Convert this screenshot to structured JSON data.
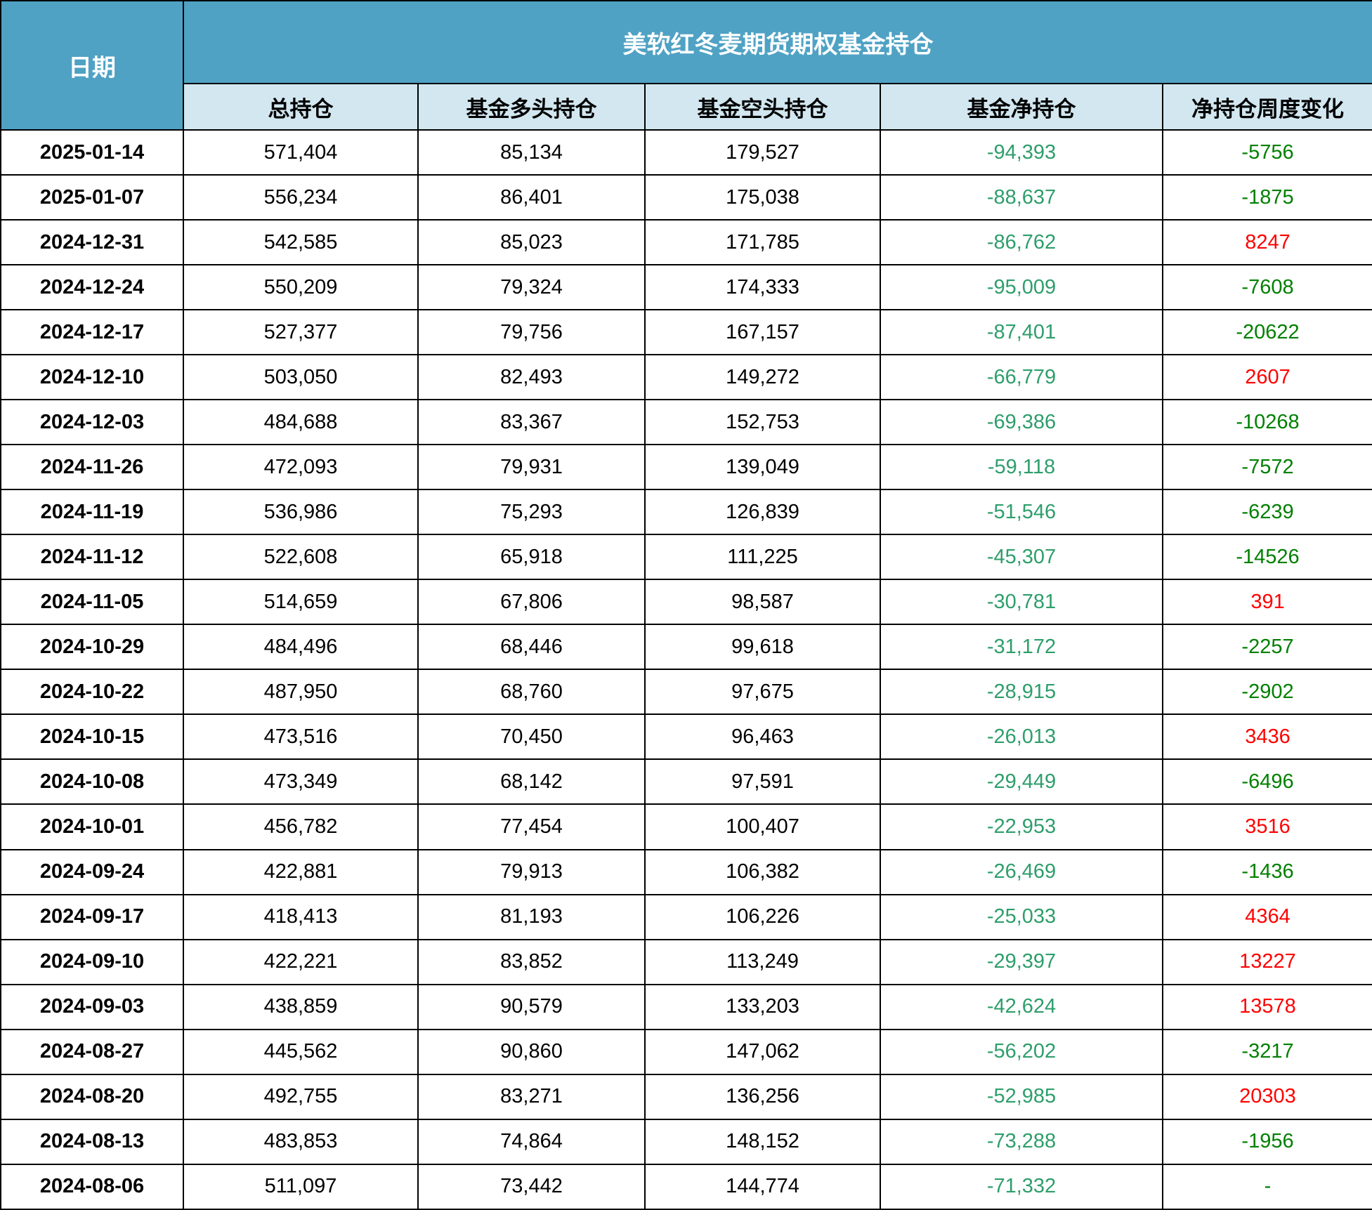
{
  "table": {
    "date_header": "日期",
    "title": "美软红冬麦期货期权基金持仓",
    "columns": [
      "总持仓",
      "基金多头持仓",
      "基金空头持仓",
      "基金净持仓",
      "净持仓周度变化"
    ],
    "colors": {
      "header_teal": "#4FA2C4",
      "subheader_blue": "#D2E7F0",
      "net_green": "#2E9E6B",
      "change_green": "#008000",
      "change_red": "#FF0000",
      "grid_black": "#000000"
    },
    "rows": [
      {
        "date": "2025-01-14",
        "total": "571,404",
        "long": "85,134",
        "short": "179,527",
        "net": "-94,393",
        "change": "-5756"
      },
      {
        "date": "2025-01-07",
        "total": "556,234",
        "long": "86,401",
        "short": "175,038",
        "net": "-88,637",
        "change": "-1875"
      },
      {
        "date": "2024-12-31",
        "total": "542,585",
        "long": "85,023",
        "short": "171,785",
        "net": "-86,762",
        "change": "8247"
      },
      {
        "date": "2024-12-24",
        "total": "550,209",
        "long": "79,324",
        "short": "174,333",
        "net": "-95,009",
        "change": "-7608"
      },
      {
        "date": "2024-12-17",
        "total": "527,377",
        "long": "79,756",
        "short": "167,157",
        "net": "-87,401",
        "change": "-20622"
      },
      {
        "date": "2024-12-10",
        "total": "503,050",
        "long": "82,493",
        "short": "149,272",
        "net": "-66,779",
        "change": "2607"
      },
      {
        "date": "2024-12-03",
        "total": "484,688",
        "long": "83,367",
        "short": "152,753",
        "net": "-69,386",
        "change": "-10268"
      },
      {
        "date": "2024-11-26",
        "total": "472,093",
        "long": "79,931",
        "short": "139,049",
        "net": "-59,118",
        "change": "-7572"
      },
      {
        "date": "2024-11-19",
        "total": "536,986",
        "long": "75,293",
        "short": "126,839",
        "net": "-51,546",
        "change": "-6239"
      },
      {
        "date": "2024-11-12",
        "total": "522,608",
        "long": "65,918",
        "short": "111,225",
        "net": "-45,307",
        "change": "-14526"
      },
      {
        "date": "2024-11-05",
        "total": "514,659",
        "long": "67,806",
        "short": "98,587",
        "net": "-30,781",
        "change": "391"
      },
      {
        "date": "2024-10-29",
        "total": "484,496",
        "long": "68,446",
        "short": "99,618",
        "net": "-31,172",
        "change": "-2257"
      },
      {
        "date": "2024-10-22",
        "total": "487,950",
        "long": "68,760",
        "short": "97,675",
        "net": "-28,915",
        "change": "-2902"
      },
      {
        "date": "2024-10-15",
        "total": "473,516",
        "long": "70,450",
        "short": "96,463",
        "net": "-26,013",
        "change": "3436"
      },
      {
        "date": "2024-10-08",
        "total": "473,349",
        "long": "68,142",
        "short": "97,591",
        "net": "-29,449",
        "change": "-6496"
      },
      {
        "date": "2024-10-01",
        "total": "456,782",
        "long": "77,454",
        "short": "100,407",
        "net": "-22,953",
        "change": "3516"
      },
      {
        "date": "2024-09-24",
        "total": "422,881",
        "long": "79,913",
        "short": "106,382",
        "net": "-26,469",
        "change": "-1436"
      },
      {
        "date": "2024-09-17",
        "total": "418,413",
        "long": "81,193",
        "short": "106,226",
        "net": "-25,033",
        "change": "4364"
      },
      {
        "date": "2024-09-10",
        "total": "422,221",
        "long": "83,852",
        "short": "113,249",
        "net": "-29,397",
        "change": "13227"
      },
      {
        "date": "2024-09-03",
        "total": "438,859",
        "long": "90,579",
        "short": "133,203",
        "net": "-42,624",
        "change": "13578"
      },
      {
        "date": "2024-08-27",
        "total": "445,562",
        "long": "90,860",
        "short": "147,062",
        "net": "-56,202",
        "change": "-3217"
      },
      {
        "date": "2024-08-20",
        "total": "492,755",
        "long": "83,271",
        "short": "136,256",
        "net": "-52,985",
        "change": "20303"
      },
      {
        "date": "2024-08-13",
        "total": "483,853",
        "long": "74,864",
        "short": "148,152",
        "net": "-73,288",
        "change": "-1956"
      },
      {
        "date": "2024-08-06",
        "total": "511,097",
        "long": "73,442",
        "short": "144,774",
        "net": "-71,332",
        "change": "-"
      }
    ]
  }
}
